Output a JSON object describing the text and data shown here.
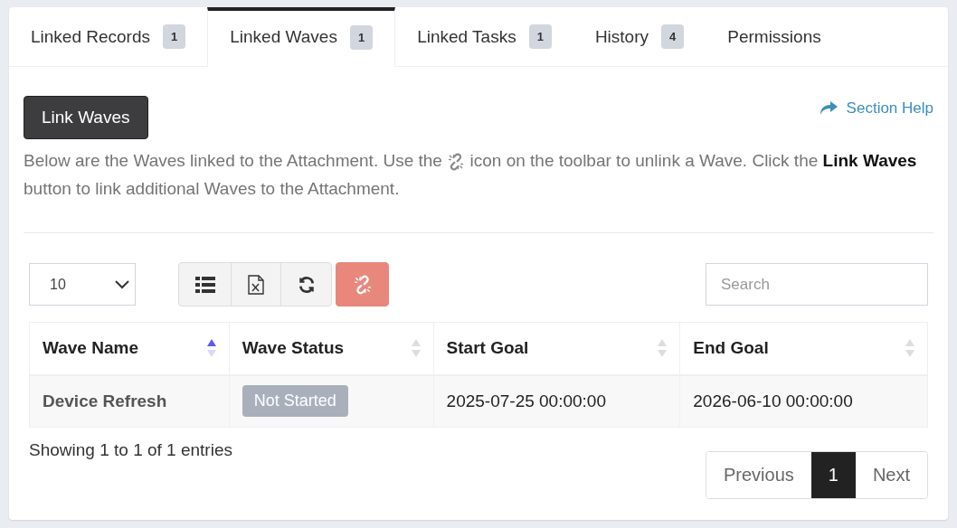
{
  "tabs": [
    {
      "label": "Linked Records",
      "count": "1",
      "selected": false
    },
    {
      "label": "Linked Waves",
      "count": "1",
      "selected": true
    },
    {
      "label": "Linked Tasks",
      "count": "1",
      "selected": false
    },
    {
      "label": "History",
      "count": "4",
      "selected": false
    },
    {
      "label": "Permissions",
      "selected": false
    }
  ],
  "link_button": "Link Waves",
  "section_help": "Section Help",
  "description": {
    "before": "Below are the Waves linked to the Attachment. Use the",
    "after": "icon on the toolbar to unlink a Wave. Click the **Link Waves** button to link additional Waves to the Attachment."
  },
  "page_size": "10",
  "toolbar": [
    {
      "kind": "columns"
    },
    {
      "kind": "excel"
    },
    {
      "kind": "refresh"
    },
    {
      "kind": "unlink"
    }
  ],
  "search": {
    "placeholder": "Search"
  },
  "table": {
    "columns": [
      {
        "label": "Wave Name",
        "sorted": true
      },
      {
        "label": "Wave Status",
        "sorted": false
      },
      {
        "label": "Start Goal",
        "sorted": false
      },
      {
        "label": "End Goal",
        "sorted": false
      }
    ],
    "rows": [
      {
        "wave_name": "Device Refresh",
        "wave_status": "Not Started",
        "start_goal": "2025-07-25 00:00:00",
        "end_goal": "2026-06-10 00:00:00"
      }
    ]
  },
  "info": "Showing 1 to 1 of 1 entries",
  "pagination": [
    {
      "label": "Previous",
      "selected": false
    },
    {
      "label": "1",
      "selected": true
    },
    {
      "label": "Next",
      "selected": false
    }
  ]
}
